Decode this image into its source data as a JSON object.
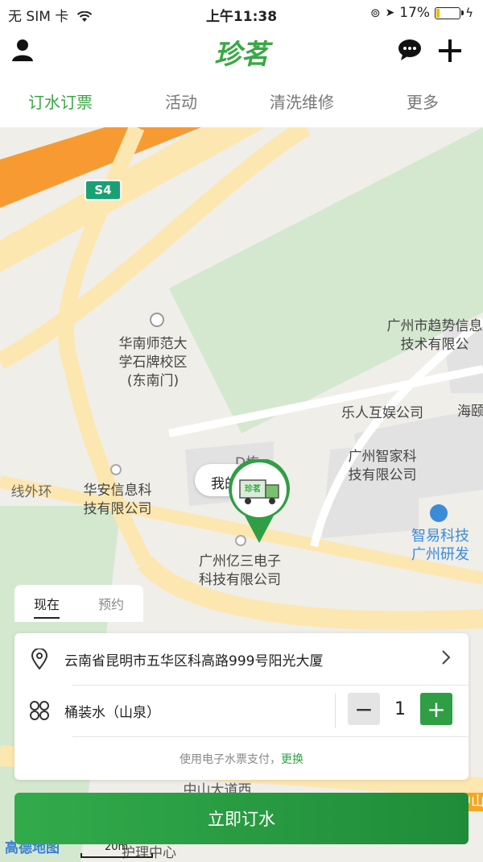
{
  "status_bar": {
    "carrier": "无 SIM 卡",
    "time": "上午11:38",
    "battery": "17%",
    "battery_level": 0.17
  },
  "header": {
    "logo_text": "珍茗",
    "icons": [
      "user-icon",
      "chat-bubble-icon",
      "plus-icon"
    ]
  },
  "tabs": [
    {
      "label": "订水订票",
      "active": true
    },
    {
      "label": "活动",
      "active": false
    },
    {
      "label": "清洗维修",
      "active": false
    },
    {
      "label": "更多",
      "active": false
    }
  ],
  "map": {
    "road_badge": "S4",
    "labels": {
      "scnu": "华南师范大\n学石牌校区\n(东南门)",
      "trend_tech": "广州市趋势信息\n技术有限公",
      "lerenhuyu": "乐人互娱公司",
      "haiyi": "海颐",
      "zhijia": "广州智家科\n技有限公司",
      "huaan": "华安信息科\n技有限公司",
      "ring_road": "线外环",
      "d_building": "D栋",
      "me_label": "我的",
      "yisan": "广州亿三电子\n科技有限公司",
      "zhiyi": "智易科技\n广州研发",
      "zhongshan": "中山大道西",
      "center": "护理中心",
      "right_edge": "中山"
    },
    "marker_logo": "珍茗",
    "amap_logo": "高德地图",
    "scale": "20m"
  },
  "mode_switch": {
    "now_label": "现在",
    "reserve_label": "预约"
  },
  "order_card": {
    "address": "云南省昆明市五华区科高路999号阳光大厦",
    "product": "桶装水（山泉）",
    "quantity": "1",
    "minus_label": "−",
    "plus_label": "+",
    "payment_note": "使用电子水票支付，",
    "payment_change": "更换"
  },
  "order_button": "立即订水",
  "colors": {
    "accent": "#39a845",
    "button_start": "#32ab4b",
    "button_end": "#1f8c39",
    "highway": "#f89a32",
    "road": "#fde7b0",
    "green_area": "#d4e8cf"
  }
}
